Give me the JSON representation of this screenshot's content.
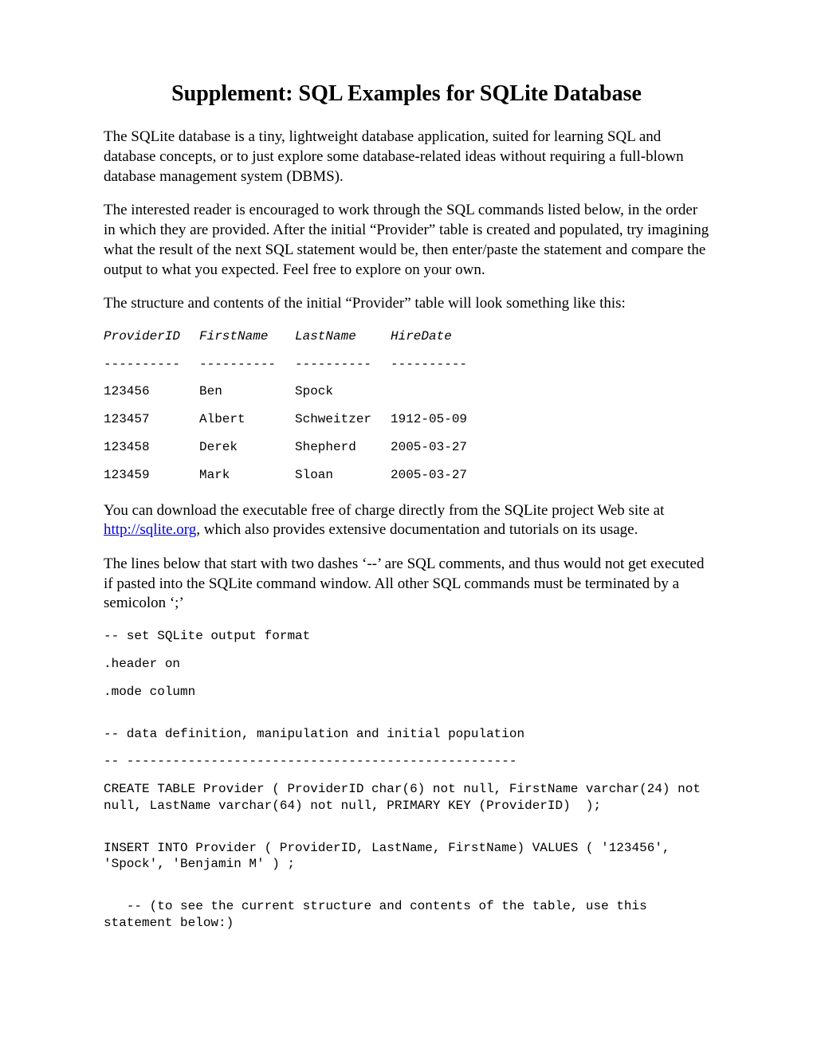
{
  "title": "Supplement: SQL Examples for SQLite Database",
  "para1": "The SQLite database is a tiny, lightweight database application, suited for learning SQL and database concepts, or to just explore some database-related ideas without requiring a full-blown database management system (DBMS).",
  "para2": "The interested reader is encouraged to work through the SQL commands listed below, in the order in which they are provided. After the initial “Provider” table is created and populated, try imagining what the result of the next SQL statement would be, then enter/paste the statement and compare the output to what you expected. Feel free to explore on your own.",
  "para3": "The structure and contents of the initial “Provider” table will look something like this:",
  "table": {
    "headers": [
      "ProviderID",
      "FirstName",
      "LastName",
      "HireDate"
    ],
    "sep": [
      "----------",
      "----------",
      "----------",
      "----------"
    ],
    "rows": [
      [
        "123456",
        "Ben",
        "Spock",
        ""
      ],
      [
        "123457",
        "Albert",
        "Schweitzer",
        "1912-05-09"
      ],
      [
        "123458",
        "Derek",
        "Shepherd",
        "2005-03-27"
      ],
      [
        "123459",
        "Mark",
        "Sloan",
        "2005-03-27"
      ]
    ]
  },
  "para4_pre": "You can download the executable free of charge directly from the SQLite project Web site at ",
  "para4_link": "http://sqlite.org",
  "para4_post": ", which also provides extensive documentation and tutorials on its usage.",
  "para5": "The lines below that start with two dashes ‘--’ are SQL comments, and thus would not get executed if pasted into the SQLite command window. All other SQL commands must be terminated by a semicolon ‘;’",
  "code": {
    "c1": "-- set SQLite output format",
    "c2": ".header on",
    "c3": ".mode column",
    "c4": "-- data definition, manipulation and initial population",
    "c5": "-- ---------------------------------------------------",
    "c6": "CREATE TABLE Provider ( ProviderID char(6) not null, FirstName varchar(24) not null, LastName varchar(64) not null, PRIMARY KEY (ProviderID)  );",
    "c7": "INSERT INTO Provider ( ProviderID, LastName, FirstName) VALUES ( '123456', 'Spock', 'Benjamin M' ) ;",
    "c8": "   -- (to see the current structure and contents of the table, use this statement below:)"
  }
}
